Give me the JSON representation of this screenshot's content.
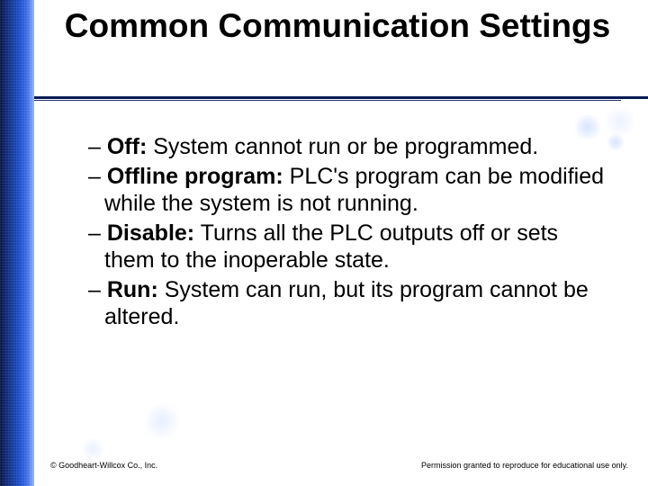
{
  "title": "Common Communication Settings",
  "items": [
    {
      "term": "Off:",
      "desc": " System cannot run or be programmed."
    },
    {
      "term": "Offline program:",
      "desc": " PLC's program can be modified while the system is not running."
    },
    {
      "term": "Disable:",
      "desc": " Turns all the PLC outputs off or sets them to the inoperable state."
    },
    {
      "term": "Run:",
      "desc": " System can run, but its program cannot be altered."
    }
  ],
  "dash": "– ",
  "footer": {
    "left": "© Goodheart-Willcox Co., Inc.",
    "right": "Permission granted to reproduce for educational use only."
  }
}
